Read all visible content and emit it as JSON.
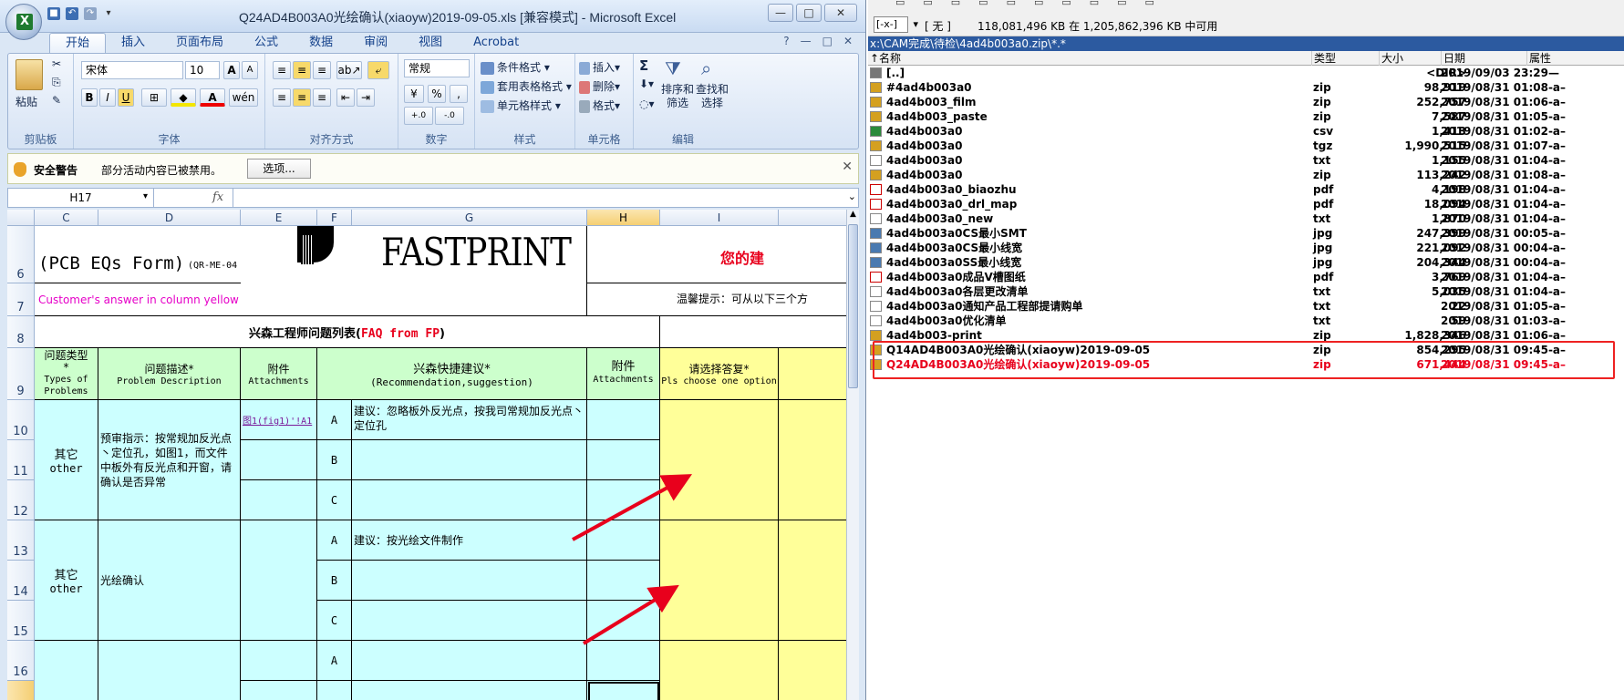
{
  "excel": {
    "window_title": "Q24AD4B003A0光绘确认(xiaoyw)2019-09-05.xls [兼容模式] - Microsoft Excel",
    "orb_letter": "X",
    "window_buttons": {
      "minimize": "—",
      "restore": "□",
      "close": "✕"
    },
    "ribbon_tabs": [
      "开始",
      "插入",
      "页面布局",
      "公式",
      "数据",
      "审阅",
      "视图",
      "Acrobat"
    ],
    "ribbon_right_icons": [
      "?",
      "—",
      "□",
      "✕"
    ],
    "groups": {
      "clipboard": {
        "label": "剪贴板",
        "paste": "粘贴"
      },
      "font": {
        "label": "字体",
        "font_name": "宋体",
        "font_size": "10",
        "grow": "A",
        "shrink": "A",
        "bold": "B",
        "italic": "I",
        "underline": "U",
        "wen": "wén"
      },
      "align": {
        "label": "对齐方式"
      },
      "number": {
        "label": "数字",
        "format": "常规",
        "percent": "%",
        "comma": ",",
        "inc_dec": "+.0",
        "dec_dec": "-.0"
      },
      "styles": {
        "label": "样式",
        "cond_format": "条件格式",
        "table_format": "套用表格格式",
        "cell_styles": "单元格样式"
      },
      "cells": {
        "label": "单元格",
        "insert": "插入",
        "delete": "删除",
        "format": "格式"
      },
      "editing": {
        "label": "编辑",
        "sigma": "Σ",
        "sort_filter": "排序和\n筛选",
        "find_select": "查找和\n选择"
      }
    },
    "security": {
      "title": "安全警告",
      "message": "部分活动内容已被禁用。",
      "options": "选项..."
    },
    "namebox": "H17",
    "fx": "fx",
    "columns": [
      "C",
      "D",
      "E",
      "F",
      "G",
      "H",
      "I"
    ],
    "rows": [
      "6",
      "7",
      "8",
      "9",
      "10",
      "11",
      "12",
      "13",
      "14",
      "15",
      "16"
    ],
    "cells": {
      "form_title": "(PCB EQs Form)",
      "form_code": "(QR-ME-04",
      "logo": "FASTPRINT",
      "suggest_red": "您的建",
      "customer_answer": "Customer's answer in column yellow ar",
      "tip": "温馨提示：可从以下三个方",
      "list_title": "兴森工程师问题列表(",
      "list_title_en": "FAQ from FP",
      "list_title_end": ")",
      "hdr_type_cn": "问题类型*",
      "hdr_type_en": "Types of Problems",
      "hdr_desc_cn": "问题描述*",
      "hdr_desc_en": "Problem Description",
      "hdr_att_cn": "附件",
      "hdr_att_en": "Attachments",
      "hdr_rec_cn": "兴森快捷建议*",
      "hdr_rec_en": "(Recommendation,suggestion)",
      "hdr_att2_cn": "附件",
      "hdr_att2_en": "Attachments",
      "hdr_choose_cn": "请选择答复*",
      "hdr_choose_en": "Pls choose one option",
      "other_cn": "其它",
      "other_en": "other",
      "desc1": "预审指示：按常规加反光点丶定位孔，如图1，而文件中板外有反光点和开窗，请确认是否异常",
      "att_link": "图1(fig1)'!A1",
      "rec_a1": "建议：忽略板外反光点，按我司常规加反光点丶定位孔",
      "desc2": "光绘确认",
      "rec_a2": "建议：按光绘文件制作",
      "opt_a": "A",
      "opt_b": "B",
      "opt_c": "C"
    }
  },
  "commander": {
    "drive_letter": "[-x-]",
    "drive_label": "[ 无 ]",
    "free_space": "118,081,496 KB 在 1,205,862,396 KB 中可用",
    "path": "x:\\CAM完成\\待检\\4ad4b003a0.zip\\*.*",
    "headers": {
      "name": "↑名称",
      "type": "类型",
      "size": "大小",
      "date": "日期",
      "attr": "属性"
    },
    "files": [
      {
        "name": "[..]",
        "type": "",
        "size": "<DIR>",
        "date": "2019/09/03 23:29—",
        "kind": "up",
        "color": "#000"
      },
      {
        "name": "#4ad4b003a0",
        "type": "zip",
        "size": "98,919",
        "date": "2019/08/31 01:08-a–",
        "kind": "zip",
        "color": "#000"
      },
      {
        "name": "4ad4b003_film",
        "type": "zip",
        "size": "252,757",
        "date": "2019/08/31 01:06-a–",
        "kind": "zip",
        "color": "#000"
      },
      {
        "name": "4ad4b003_paste",
        "type": "zip",
        "size": "7,587",
        "date": "2019/08/31 01:05-a–",
        "kind": "zip",
        "color": "#000"
      },
      {
        "name": "4ad4b003a0",
        "type": "csv",
        "size": "1,413",
        "date": "2019/08/31 01:02-a–",
        "kind": "csv",
        "color": "#000"
      },
      {
        "name": "4ad4b003a0",
        "type": "tgz",
        "size": "1,990,515",
        "date": "2019/08/31 01:07-a–",
        "kind": "zip",
        "color": "#000"
      },
      {
        "name": "4ad4b003a0",
        "type": "txt",
        "size": "1,155",
        "date": "2019/08/31 01:04-a–",
        "kind": "txt",
        "color": "#000"
      },
      {
        "name": "4ad4b003a0",
        "type": "zip",
        "size": "113,242",
        "date": "2019/08/31 01:08-a–",
        "kind": "zip",
        "color": "#000"
      },
      {
        "name": "4ad4b003a0_biaozhu",
        "type": "pdf",
        "size": "4,198",
        "date": "2019/08/31 01:04-a–",
        "kind": "pdf",
        "color": "#000"
      },
      {
        "name": "4ad4b003a0_drl_map",
        "type": "pdf",
        "size": "18,094",
        "date": "2019/08/31 01:04-a–",
        "kind": "pdf",
        "color": "#000"
      },
      {
        "name": "4ad4b003a0_new",
        "type": "txt",
        "size": "1,870",
        "date": "2019/08/31 01:04-a–",
        "kind": "txt",
        "color": "#000"
      },
      {
        "name": "4ad4b003a0CS最小SMT",
        "type": "jpg",
        "size": "247,399",
        "date": "2019/08/31 00:05-a–",
        "kind": "jpg",
        "color": "#000"
      },
      {
        "name": "4ad4b003a0CS最小线宽",
        "type": "jpg",
        "size": "221,092",
        "date": "2019/08/31 00:04-a–",
        "kind": "jpg",
        "color": "#000"
      },
      {
        "name": "4ad4b003a0SS最小线宽",
        "type": "jpg",
        "size": "204,344",
        "date": "2019/08/31 00:04-a–",
        "kind": "jpg",
        "color": "#000"
      },
      {
        "name": "4ad4b003a0成品V槽图纸",
        "type": "pdf",
        "size": "3,769",
        "date": "2019/08/31 01:04-a–",
        "kind": "pdf",
        "color": "#000"
      },
      {
        "name": "4ad4b003a0各层更改清单",
        "type": "txt",
        "size": "5,035",
        "date": "2019/08/31 01:04-a–",
        "kind": "txt",
        "color": "#000"
      },
      {
        "name": "4ad4b003a0通知产品工程部提请购单",
        "type": "txt",
        "size": "22",
        "date": "2019/08/31 01:05-a–",
        "kind": "txt",
        "color": "#000"
      },
      {
        "name": "4ad4b003a0优化清单",
        "type": "txt",
        "size": "59",
        "date": "2019/08/31 01:03-a–",
        "kind": "txt",
        "color": "#000"
      },
      {
        "name": "4ad4b003-print",
        "type": "zip",
        "size": "1,828,346",
        "date": "2019/08/31 01:06-a–",
        "kind": "zip",
        "color": "#000"
      },
      {
        "name": "Q14AD4B003A0光绘确认(xiaoyw)2019-09-05",
        "type": "zip",
        "size": "854,295",
        "date": "2019/08/31 09:45-a–",
        "kind": "zip",
        "color": "#000"
      },
      {
        "name": "Q24AD4B003A0光绘确认(xiaoyw)2019-09-05",
        "type": "zip",
        "size": "671,444",
        "date": "2019/08/31 09:45-a–",
        "kind": "zip",
        "color": "#e8001c"
      }
    ]
  },
  "colors": {
    "highlight_red": "#e22222",
    "annotation_arrow": "#e8001c",
    "path_bar": "#2c5aa0"
  }
}
